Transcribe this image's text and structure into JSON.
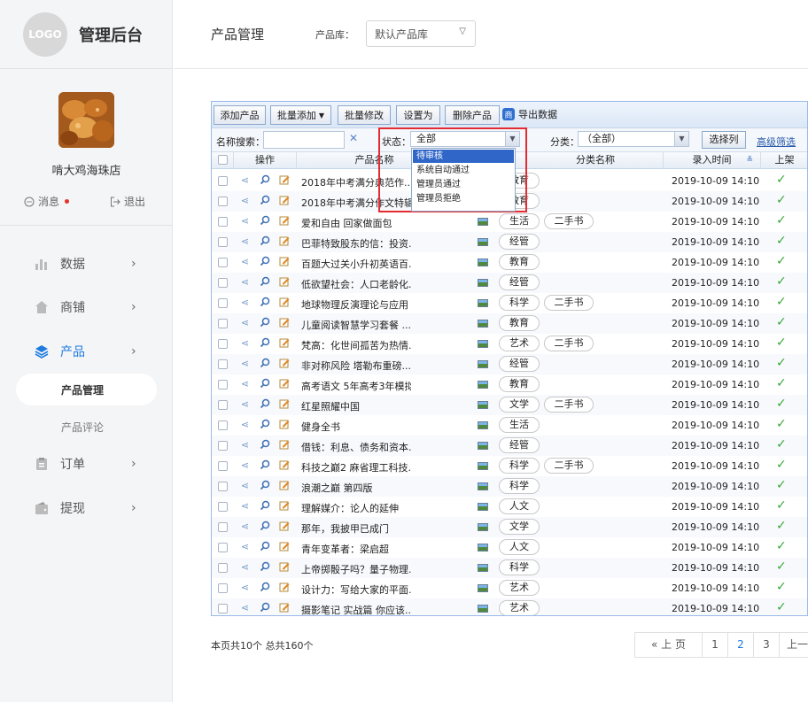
{
  "app": {
    "logo_text": "LOGO",
    "title": "管理后台"
  },
  "shop": {
    "name": "啃大鸡海珠店",
    "messages_label": "消息",
    "logout_label": "退出"
  },
  "nav": [
    {
      "label": "数据",
      "icon": "bar-chart-icon"
    },
    {
      "label": "商铺",
      "icon": "house-icon"
    },
    {
      "label": "产品",
      "icon": "layers-icon",
      "active": true
    },
    {
      "label": "订单",
      "icon": "clipboard-icon"
    },
    {
      "label": "提现",
      "icon": "wallet-icon"
    }
  ],
  "subnav": [
    {
      "label": "产品管理",
      "active": true
    },
    {
      "label": "产品评论"
    }
  ],
  "header": {
    "page_title": "产品管理",
    "lib_label": "产品库：",
    "lib_value": "默认产品库"
  },
  "toolbar": {
    "add": "添加产品",
    "batch_add": "批量添加",
    "batch_edit": "批量修改",
    "set_as": "设置为",
    "delete": "删除产品",
    "export": "导出数据",
    "export_icon": "商"
  },
  "filters": {
    "name_label": "名称搜索：",
    "clear": "✕",
    "status_label": "状态：",
    "status_value": "全部",
    "category_label": "分类：",
    "category_value": "（全部）",
    "choose_columns": "选择列",
    "advanced": "高级筛选"
  },
  "status_options": [
    "待审核",
    "系统自动通过",
    "管理员通过",
    "管理员拒绝"
  ],
  "columns": {
    "ops": "操作",
    "name": "产品名称",
    "category": "分类名称",
    "time": "录入时间",
    "listed": "上架"
  },
  "rows": [
    {
      "name": "2018年中考满分典范作...",
      "cat1": "教育",
      "cat2": "",
      "time": "2019-10-09 14:10"
    },
    {
      "name": "2018年中考满分作文特辑",
      "cat1": "教育",
      "cat2": "",
      "time": "2019-10-09 14:10"
    },
    {
      "name": "爱和自由 回家做面包",
      "cat1": "生活",
      "cat2": "二手书",
      "time": "2019-10-09 14:10"
    },
    {
      "name": "巴菲特致股东的信：投资...",
      "cat1": "经管",
      "cat2": "",
      "time": "2019-10-09 14:10"
    },
    {
      "name": "百题大过关小升初英语百...",
      "cat1": "教育",
      "cat2": "",
      "time": "2019-10-09 14:10"
    },
    {
      "name": "低欲望社会：人口老龄化...",
      "cat1": "经管",
      "cat2": "",
      "time": "2019-10-09 14:10"
    },
    {
      "name": "地球物理反演理论与应用",
      "cat1": "科学",
      "cat2": "二手书",
      "time": "2019-10-09 14:10"
    },
    {
      "name": "儿童阅读智慧学习套餐 ...",
      "cat1": "教育",
      "cat2": "",
      "time": "2019-10-09 14:10"
    },
    {
      "name": "梵高：化世间孤苦为热情...",
      "cat1": "艺术",
      "cat2": "二手书",
      "time": "2019-10-09 14:10"
    },
    {
      "name": "非对称风险 塔勒布重磅...",
      "cat1": "经管",
      "cat2": "",
      "time": "2019-10-09 14:10"
    },
    {
      "name": "高考语文 5年高考3年模拟",
      "cat1": "教育",
      "cat2": "",
      "time": "2019-10-09 14:10"
    },
    {
      "name": "红星照耀中国",
      "cat1": "文学",
      "cat2": "二手书",
      "time": "2019-10-09 14:10"
    },
    {
      "name": "健身全书",
      "cat1": "生活",
      "cat2": "",
      "time": "2019-10-09 14:10"
    },
    {
      "name": "借钱：利息、债务和资本...",
      "cat1": "经管",
      "cat2": "",
      "time": "2019-10-09 14:10"
    },
    {
      "name": "科技之巅2 麻省理工科技...",
      "cat1": "科学",
      "cat2": "二手书",
      "time": "2019-10-09 14:10"
    },
    {
      "name": "浪潮之巅 第四版",
      "cat1": "科学",
      "cat2": "",
      "time": "2019-10-09 14:10"
    },
    {
      "name": "理解媒介：论人的延伸",
      "cat1": "人文",
      "cat2": "",
      "time": "2019-10-09 14:10"
    },
    {
      "name": "那年，我披甲已成门",
      "cat1": "文学",
      "cat2": "",
      "time": "2019-10-09 14:10"
    },
    {
      "name": "青年变革者：梁启超",
      "cat1": "人文",
      "cat2": "",
      "time": "2019-10-09 14:10"
    },
    {
      "name": "上帝掷骰子吗？量子物理...",
      "cat1": "科学",
      "cat2": "",
      "time": "2019-10-09 14:10"
    },
    {
      "name": "设计力：写给大家的平面...",
      "cat1": "艺术",
      "cat2": "",
      "time": "2019-10-09 14:10"
    },
    {
      "name": "摄影笔记 实战篇 你应该...",
      "cat1": "艺术",
      "cat2": "",
      "time": "2019-10-09 14:10"
    }
  ],
  "footer": {
    "summary": "本页共10个  总共160个",
    "prev": "« 上 页",
    "pages": [
      "1",
      "2",
      "3"
    ],
    "current_page": "2",
    "prev_short": "上一"
  },
  "colors": {
    "accent": "#1e7be0",
    "highlight": "#e52b32",
    "check": "#3aa83a"
  }
}
